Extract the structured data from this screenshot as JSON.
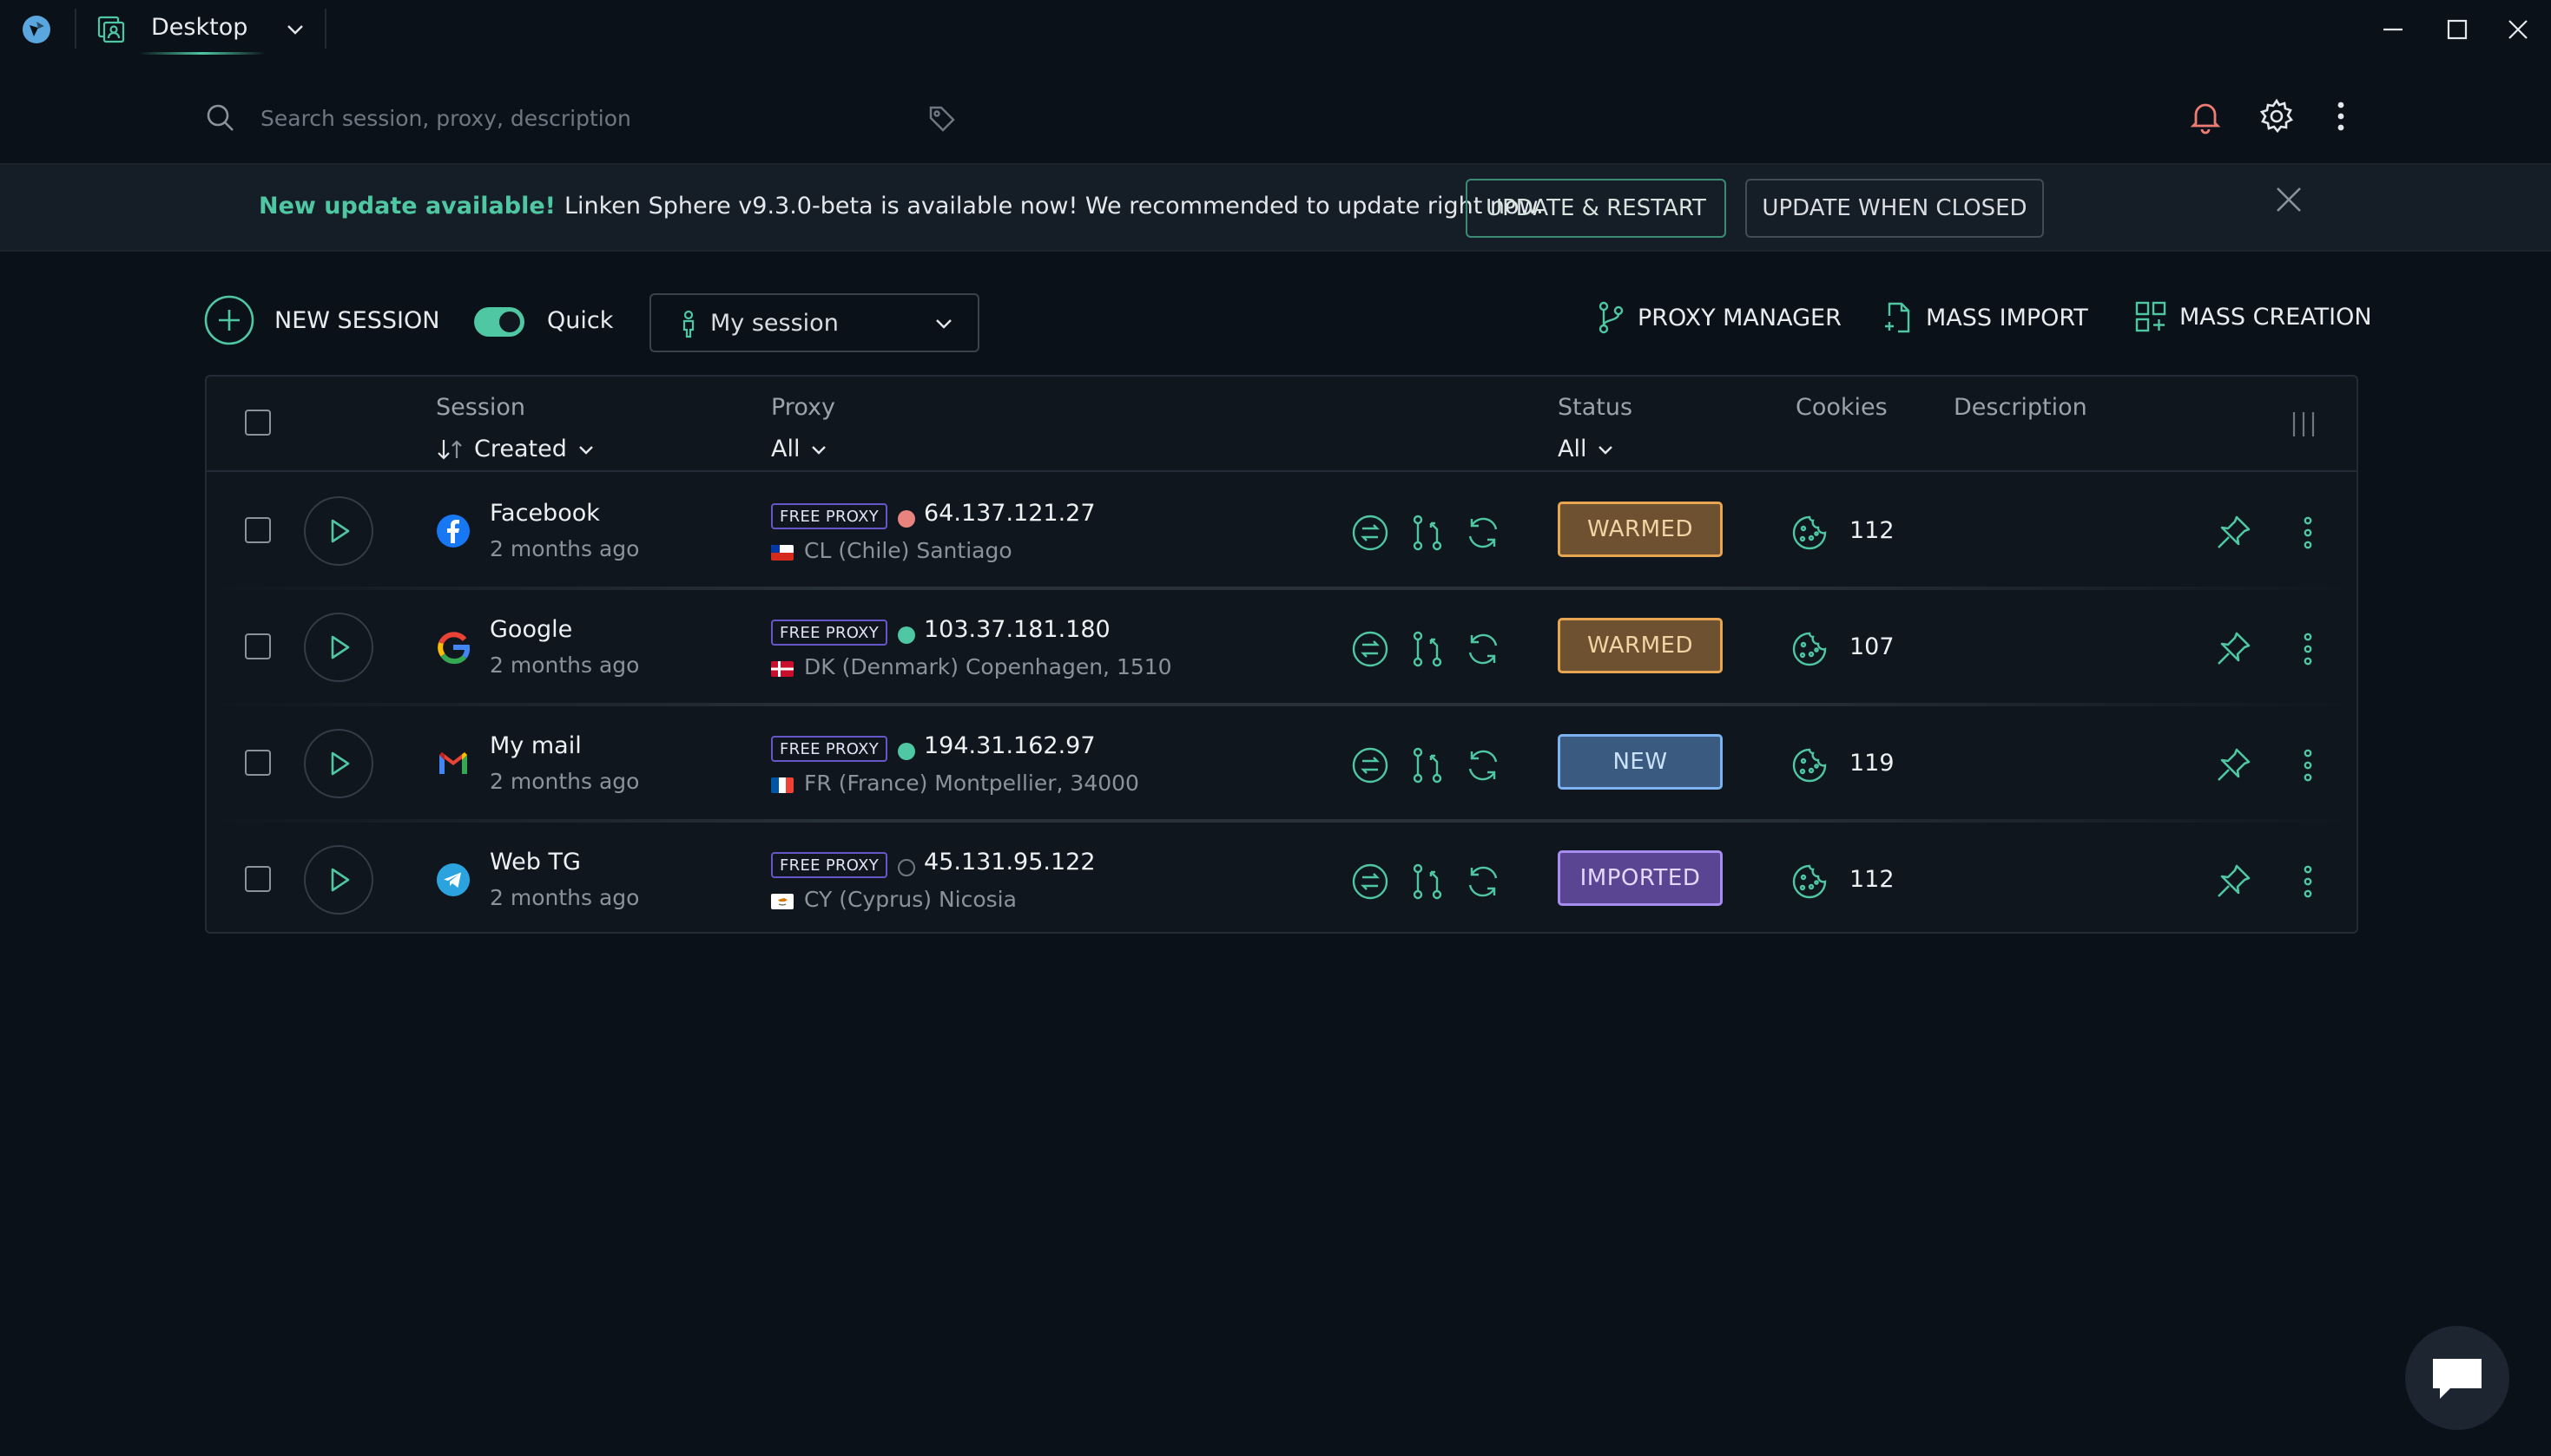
{
  "titlebar": {
    "workspace": "Desktop",
    "icons": [
      "app-logo",
      "workspace-icon",
      "chevron-down-icon",
      "minimize-icon",
      "maximize-icon",
      "close-icon"
    ]
  },
  "search": {
    "placeholder": "Search session, proxy, description"
  },
  "banner": {
    "highlight": "New update available!",
    "message": "Linken Sphere v9.3.0-beta  is available now! We recommended to update right now.",
    "restart_label": "UPDATE & RESTART",
    "closed_label": "UPDATE WHEN CLOSED"
  },
  "toolbar": {
    "new_session": "NEW SESSION",
    "quick_label": "Quick",
    "quick_on": true,
    "session_select": "My session",
    "proxy_manager": "PROXY MANAGER",
    "mass_import": "MASS IMPORT",
    "mass_creation": "MASS CREATION"
  },
  "table": {
    "headers": {
      "session": "Session",
      "session_sort": "Created",
      "proxy": "Proxy",
      "proxy_filter": "All",
      "status": "Status",
      "status_filter": "All",
      "cookies": "Cookies",
      "description": "Description"
    },
    "rows": [
      {
        "name": "Facebook",
        "time": "2 months ago",
        "site_icon": "facebook-icon",
        "proxy_badge": "FREE PROXY",
        "proxy_status": "error",
        "ip": "64.137.121.27",
        "location": "CL (Chile) Santiago",
        "flag": "cl",
        "status": "WARMED",
        "status_kind": "warmed",
        "cookies": "112"
      },
      {
        "name": "Google",
        "time": "2 months ago",
        "site_icon": "google-icon",
        "proxy_badge": "FREE PROXY",
        "proxy_status": "ok",
        "ip": "103.37.181.180",
        "location": "DK (Denmark) Copenhagen, 1510",
        "flag": "dk",
        "status": "WARMED",
        "status_kind": "warmed",
        "cookies": "107"
      },
      {
        "name": "My mail",
        "time": "2 months ago",
        "site_icon": "gmail-icon",
        "proxy_badge": "FREE PROXY",
        "proxy_status": "ok",
        "ip": "194.31.162.97",
        "location": "FR (France) Montpellier, 34000",
        "flag": "fr",
        "status": "NEW",
        "status_kind": "new",
        "cookies": "119"
      },
      {
        "name": "Web TG",
        "time": "2 months ago",
        "site_icon": "telegram-icon",
        "proxy_badge": "FREE PROXY",
        "proxy_status": "unknown",
        "ip": "45.131.95.122",
        "location": "CY (Cyprus) Nicosia",
        "flag": "cy",
        "status": "IMPORTED",
        "status_kind": "imported",
        "cookies": "112"
      }
    ]
  },
  "colors": {
    "background": "#0b1119",
    "accent": "#4fc7a3",
    "warmed": "#e8a551",
    "new": "#7cb2ef",
    "imported": "#a88df0",
    "proxy_ok": "#4fc7a3",
    "proxy_error": "#e8837e",
    "notification": "#ef7c73"
  }
}
